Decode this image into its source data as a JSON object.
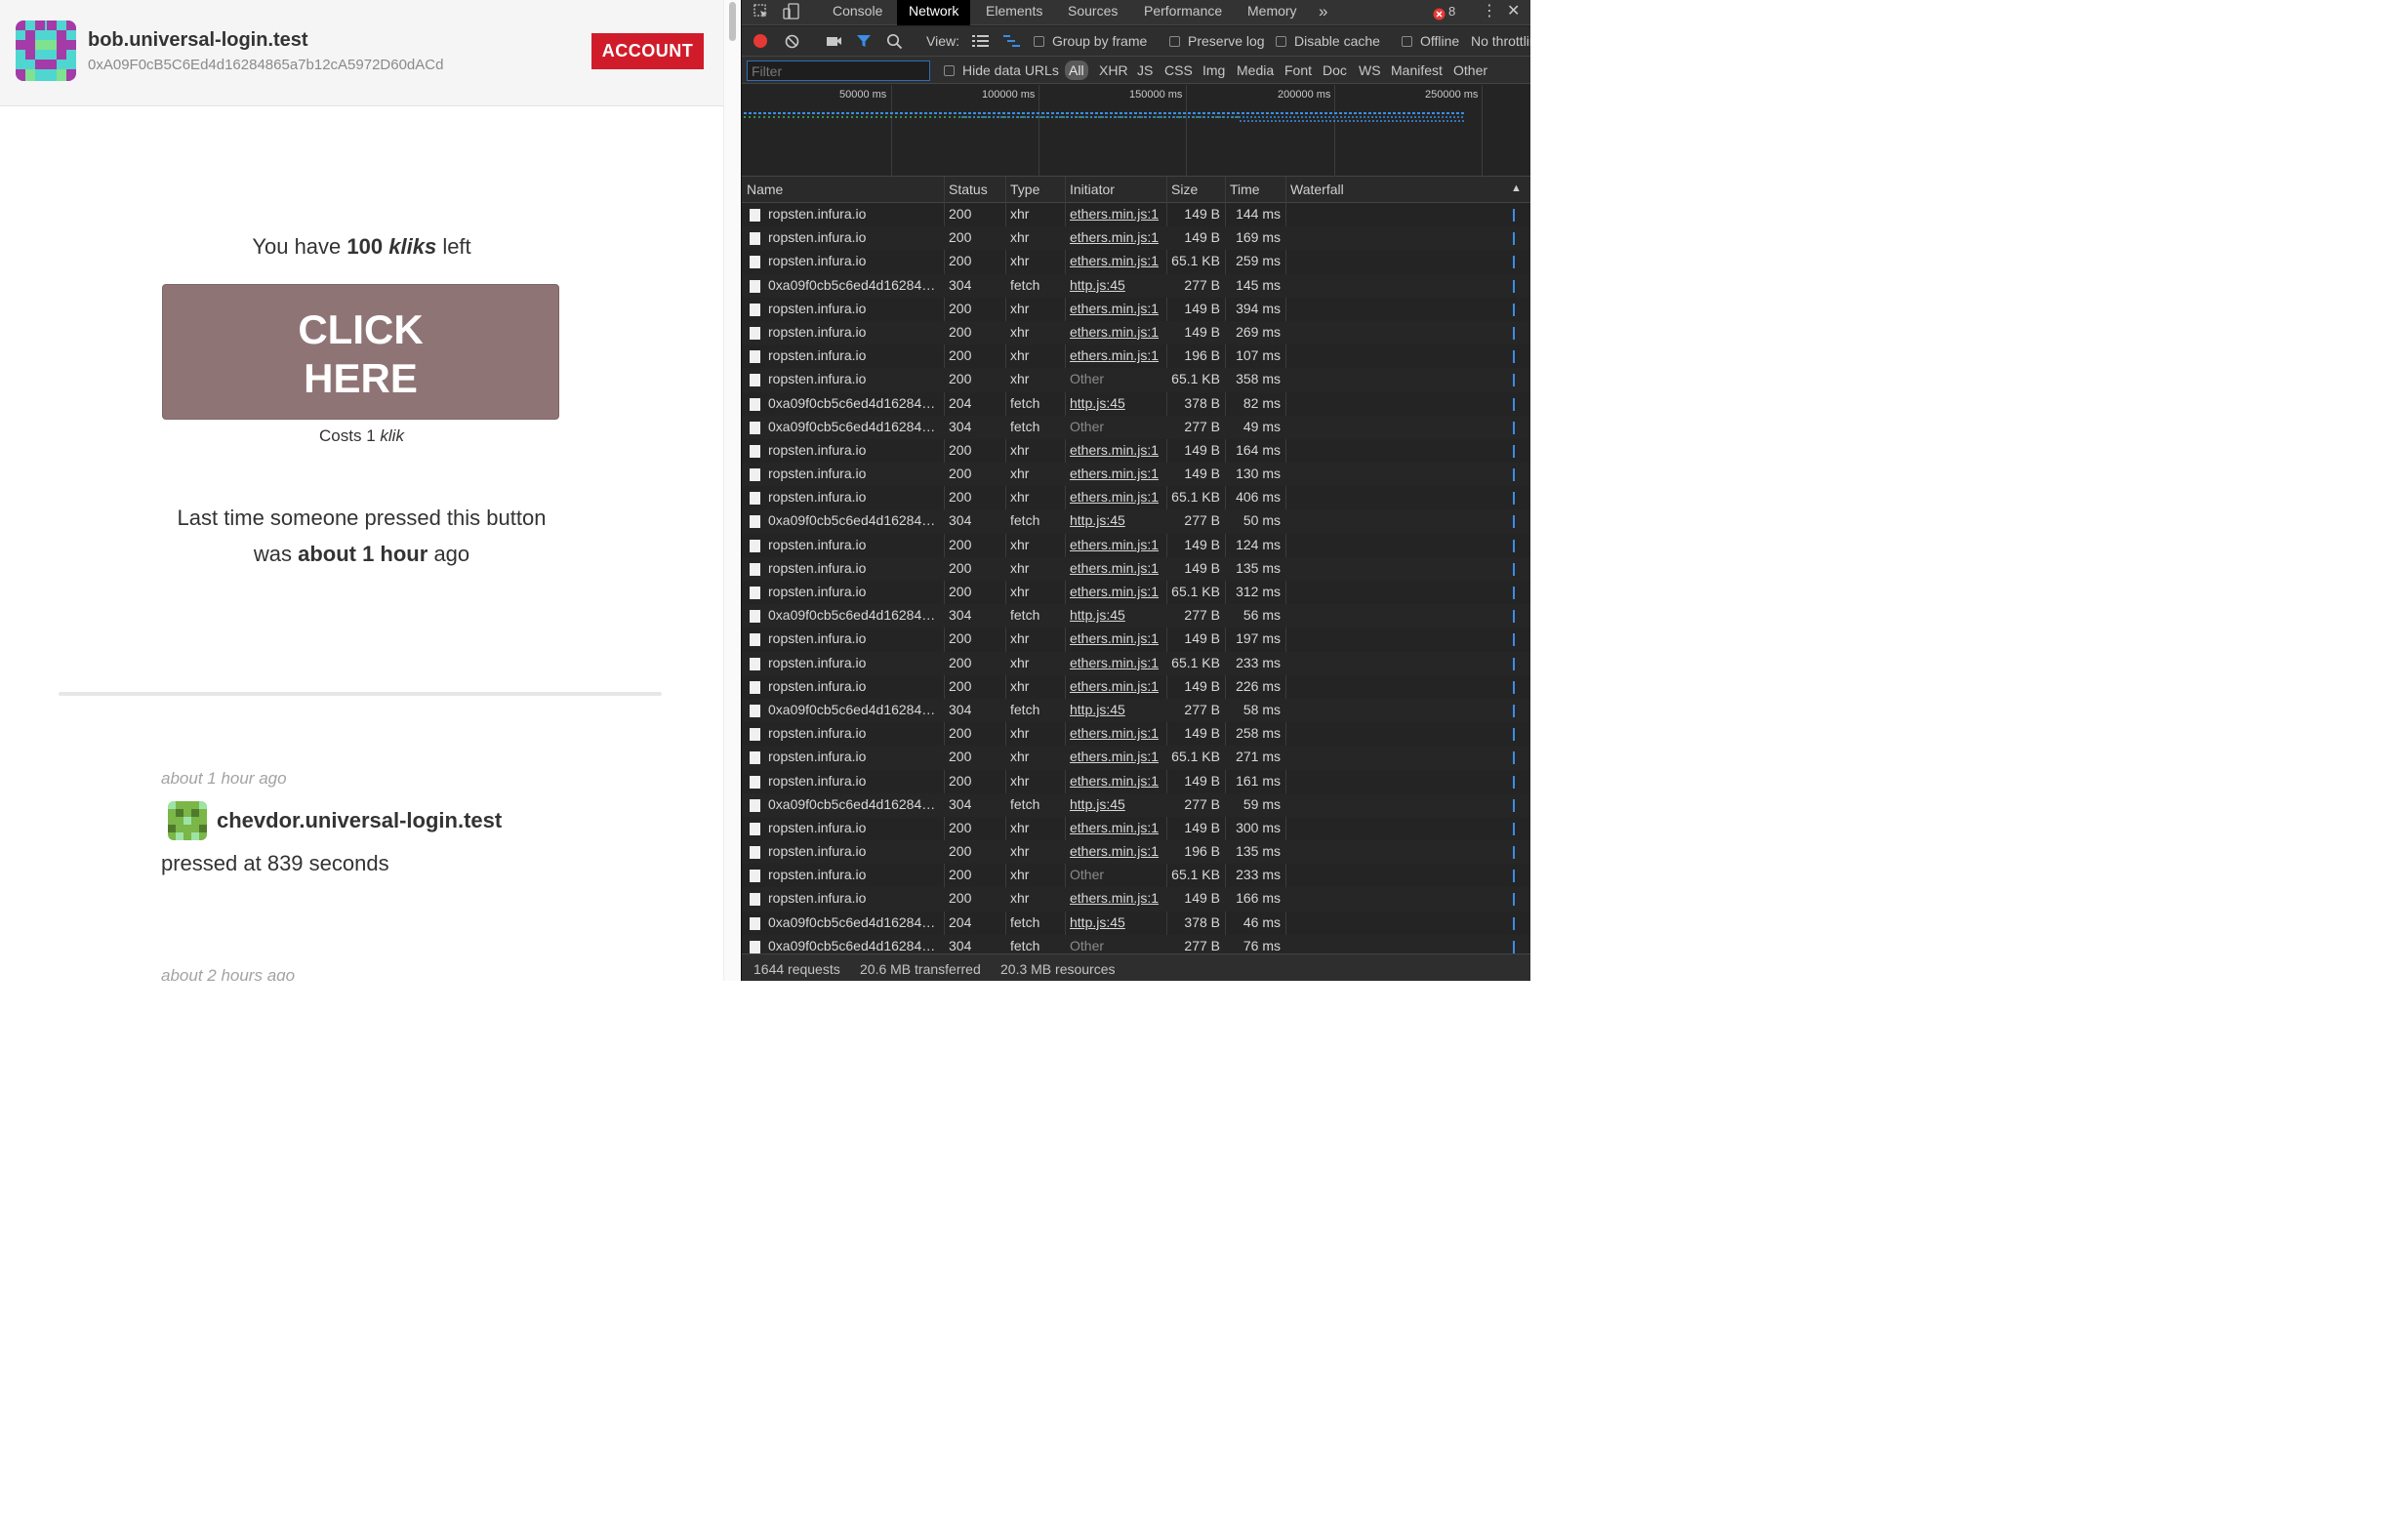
{
  "app": {
    "user_name": "bob.universal-login.test",
    "user_address": "0xA09F0cB5C6Ed4d16284865a7b12cA5972D60dACd",
    "account_label": "ACCOUNT",
    "kliks_prefix": "You have",
    "kliks_count": "100",
    "kliks_unit": "kliks",
    "kliks_suffix": "left",
    "click_line1": "CLICK",
    "click_line2": "HERE",
    "cost_prefix": "Costs 1",
    "cost_unit": "klik",
    "last_press_line1": "Last time someone pressed this button",
    "last_press_prefix": "was",
    "last_press_value": "about 1 hour",
    "last_press_suffix": "ago",
    "history": [
      {
        "time": "about 1 hour ago",
        "name": "chevdor.universal-login.test",
        "desc": "pressed at 839 seconds"
      },
      {
        "time": "about 2 hours ago"
      }
    ]
  },
  "devtools": {
    "tabs": [
      "Console",
      "Network",
      "Elements",
      "Sources",
      "Performance",
      "Memory"
    ],
    "more": "»",
    "error_count": "8",
    "toolbar": {
      "view": "View:",
      "group_by_frame": "Group by frame",
      "preserve_log": "Preserve log",
      "disable_cache": "Disable cache",
      "offline": "Offline",
      "throttle": "No throttling"
    },
    "filter": {
      "placeholder": "Filter",
      "hide_data_urls": "Hide data URLs",
      "types": [
        "All",
        "XHR",
        "JS",
        "CSS",
        "Img",
        "Media",
        "Font",
        "Doc",
        "WS",
        "Manifest",
        "Other"
      ]
    },
    "overview_ticks": [
      "50000 ms",
      "100000 ms",
      "150000 ms",
      "200000 ms",
      "250000 ms"
    ],
    "columns": [
      "Name",
      "Status",
      "Type",
      "Initiator",
      "Size",
      "Time",
      "Waterfall"
    ],
    "rows": [
      {
        "name": "ropsten.infura.io",
        "status": "200",
        "type": "xhr",
        "initiator": "ethers.min.js:1",
        "size": "149 B",
        "time": "144 ms"
      },
      {
        "name": "ropsten.infura.io",
        "status": "200",
        "type": "xhr",
        "initiator": "ethers.min.js:1",
        "size": "149 B",
        "time": "169 ms"
      },
      {
        "name": "ropsten.infura.io",
        "status": "200",
        "type": "xhr",
        "initiator": "ethers.min.js:1",
        "size": "65.1 KB",
        "time": "259 ms"
      },
      {
        "name": "0xa09f0cb5c6ed4d16284…",
        "status": "304",
        "type": "fetch",
        "initiator": "http.js:45",
        "size": "277 B",
        "time": "145 ms"
      },
      {
        "name": "ropsten.infura.io",
        "status": "200",
        "type": "xhr",
        "initiator": "ethers.min.js:1",
        "size": "149 B",
        "time": "394 ms"
      },
      {
        "name": "ropsten.infura.io",
        "status": "200",
        "type": "xhr",
        "initiator": "ethers.min.js:1",
        "size": "149 B",
        "time": "269 ms"
      },
      {
        "name": "ropsten.infura.io",
        "status": "200",
        "type": "xhr",
        "initiator": "ethers.min.js:1",
        "size": "196 B",
        "time": "107 ms"
      },
      {
        "name": "ropsten.infura.io",
        "status": "200",
        "type": "xhr",
        "initiator": "Other",
        "size": "65.1 KB",
        "time": "358 ms"
      },
      {
        "name": "0xa09f0cb5c6ed4d16284…",
        "status": "204",
        "type": "fetch",
        "initiator": "http.js:45",
        "size": "378 B",
        "time": "82 ms"
      },
      {
        "name": "0xa09f0cb5c6ed4d16284…",
        "status": "304",
        "type": "fetch",
        "initiator": "Other",
        "size": "277 B",
        "time": "49 ms"
      },
      {
        "name": "ropsten.infura.io",
        "status": "200",
        "type": "xhr",
        "initiator": "ethers.min.js:1",
        "size": "149 B",
        "time": "164 ms"
      },
      {
        "name": "ropsten.infura.io",
        "status": "200",
        "type": "xhr",
        "initiator": "ethers.min.js:1",
        "size": "149 B",
        "time": "130 ms"
      },
      {
        "name": "ropsten.infura.io",
        "status": "200",
        "type": "xhr",
        "initiator": "ethers.min.js:1",
        "size": "65.1 KB",
        "time": "406 ms"
      },
      {
        "name": "0xa09f0cb5c6ed4d16284…",
        "status": "304",
        "type": "fetch",
        "initiator": "http.js:45",
        "size": "277 B",
        "time": "50 ms"
      },
      {
        "name": "ropsten.infura.io",
        "status": "200",
        "type": "xhr",
        "initiator": "ethers.min.js:1",
        "size": "149 B",
        "time": "124 ms"
      },
      {
        "name": "ropsten.infura.io",
        "status": "200",
        "type": "xhr",
        "initiator": "ethers.min.js:1",
        "size": "149 B",
        "time": "135 ms"
      },
      {
        "name": "ropsten.infura.io",
        "status": "200",
        "type": "xhr",
        "initiator": "ethers.min.js:1",
        "size": "65.1 KB",
        "time": "312 ms"
      },
      {
        "name": "0xa09f0cb5c6ed4d16284…",
        "status": "304",
        "type": "fetch",
        "initiator": "http.js:45",
        "size": "277 B",
        "time": "56 ms"
      },
      {
        "name": "ropsten.infura.io",
        "status": "200",
        "type": "xhr",
        "initiator": "ethers.min.js:1",
        "size": "149 B",
        "time": "197 ms"
      },
      {
        "name": "ropsten.infura.io",
        "status": "200",
        "type": "xhr",
        "initiator": "ethers.min.js:1",
        "size": "65.1 KB",
        "time": "233 ms"
      },
      {
        "name": "ropsten.infura.io",
        "status": "200",
        "type": "xhr",
        "initiator": "ethers.min.js:1",
        "size": "149 B",
        "time": "226 ms"
      },
      {
        "name": "0xa09f0cb5c6ed4d16284…",
        "status": "304",
        "type": "fetch",
        "initiator": "http.js:45",
        "size": "277 B",
        "time": "58 ms"
      },
      {
        "name": "ropsten.infura.io",
        "status": "200",
        "type": "xhr",
        "initiator": "ethers.min.js:1",
        "size": "149 B",
        "time": "258 ms"
      },
      {
        "name": "ropsten.infura.io",
        "status": "200",
        "type": "xhr",
        "initiator": "ethers.min.js:1",
        "size": "65.1 KB",
        "time": "271 ms"
      },
      {
        "name": "ropsten.infura.io",
        "status": "200",
        "type": "xhr",
        "initiator": "ethers.min.js:1",
        "size": "149 B",
        "time": "161 ms"
      },
      {
        "name": "0xa09f0cb5c6ed4d16284…",
        "status": "304",
        "type": "fetch",
        "initiator": "http.js:45",
        "size": "277 B",
        "time": "59 ms"
      },
      {
        "name": "ropsten.infura.io",
        "status": "200",
        "type": "xhr",
        "initiator": "ethers.min.js:1",
        "size": "149 B",
        "time": "300 ms"
      },
      {
        "name": "ropsten.infura.io",
        "status": "200",
        "type": "xhr",
        "initiator": "ethers.min.js:1",
        "size": "196 B",
        "time": "135 ms"
      },
      {
        "name": "ropsten.infura.io",
        "status": "200",
        "type": "xhr",
        "initiator": "Other",
        "size": "65.1 KB",
        "time": "233 ms"
      },
      {
        "name": "ropsten.infura.io",
        "status": "200",
        "type": "xhr",
        "initiator": "ethers.min.js:1",
        "size": "149 B",
        "time": "166 ms"
      },
      {
        "name": "0xa09f0cb5c6ed4d16284…",
        "status": "204",
        "type": "fetch",
        "initiator": "http.js:45",
        "size": "378 B",
        "time": "46 ms"
      },
      {
        "name": "0xa09f0cb5c6ed4d16284…",
        "status": "304",
        "type": "fetch",
        "initiator": "Other",
        "size": "277 B",
        "time": "76 ms"
      }
    ],
    "status_bar": {
      "requests": "1644 requests",
      "transferred": "20.6 MB transferred",
      "resources": "20.3 MB resources"
    }
  },
  "colors": {
    "account_button": "#d01c2a",
    "click_button": "#8f7476",
    "devtools_bg": "#242424"
  }
}
